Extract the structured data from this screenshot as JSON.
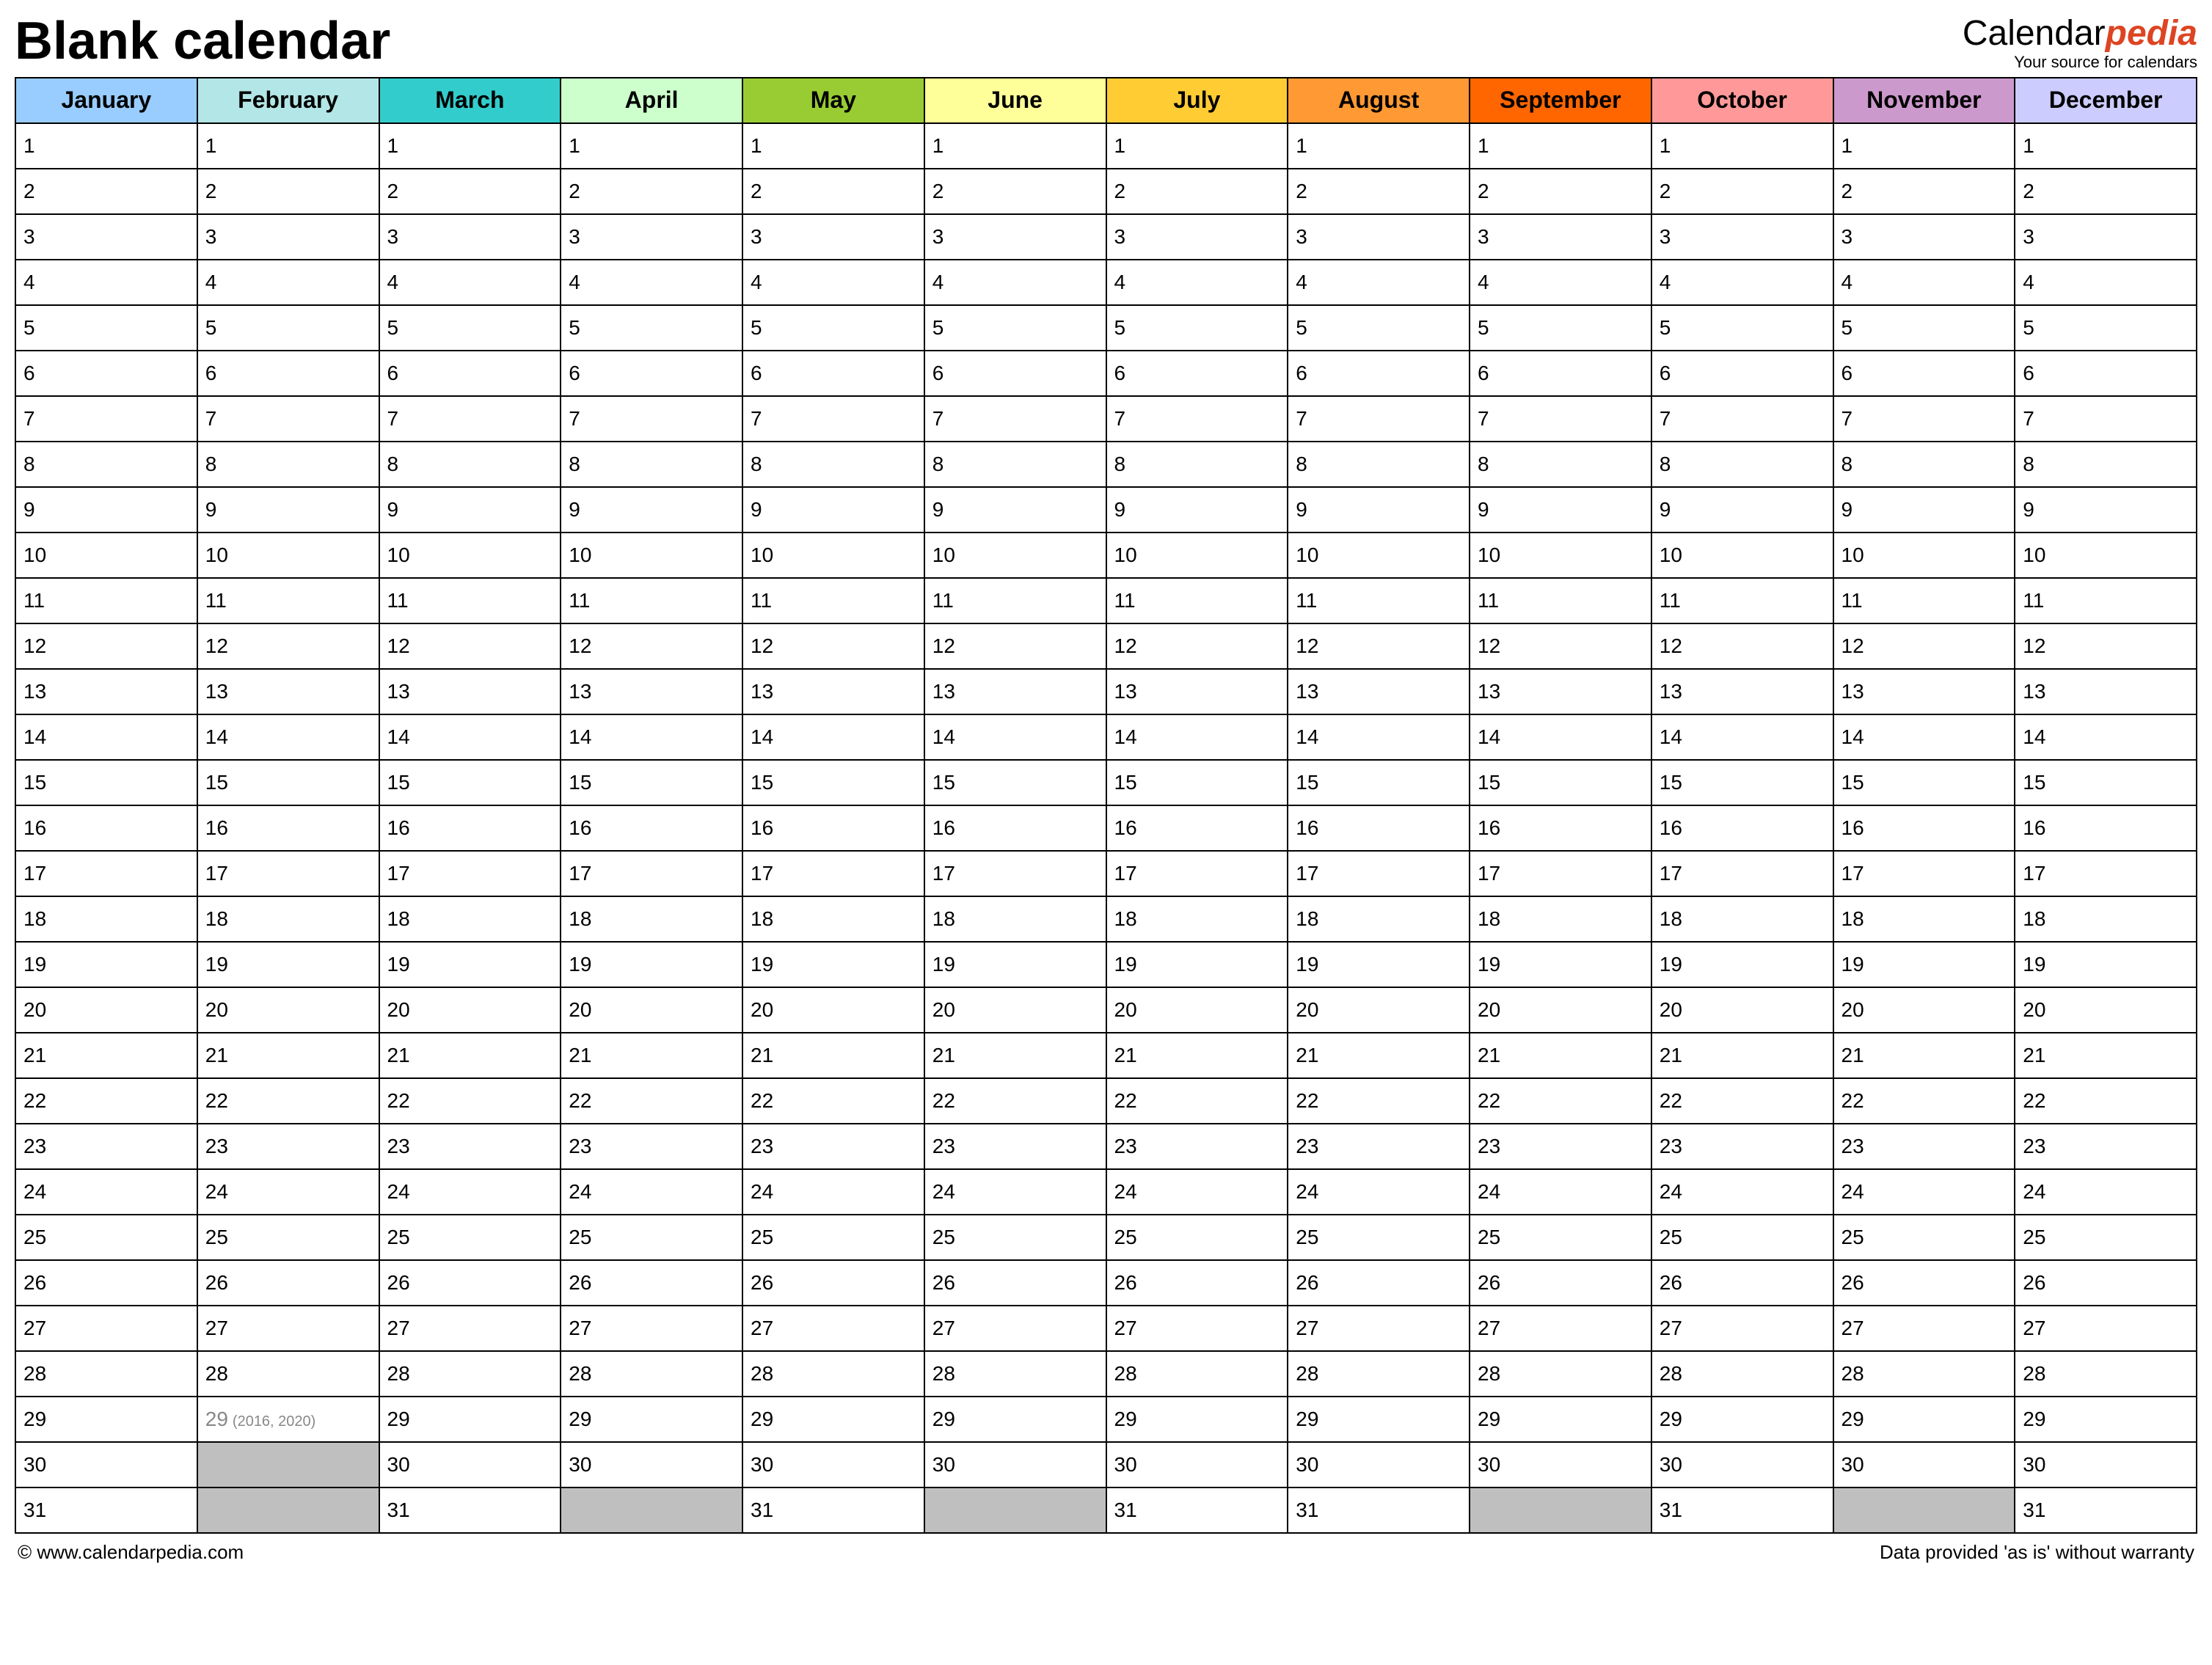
{
  "title": "Blank calendar",
  "logo": {
    "part1": "Calendar",
    "part2": "pedia",
    "tagline": "Your source for calendars"
  },
  "months": [
    {
      "name": "January",
      "color": "#99ccff",
      "days": 31
    },
    {
      "name": "February",
      "color": "#b3e6e6",
      "days": 28,
      "leap": {
        "day": 29,
        "note": "(2016, 2020)"
      }
    },
    {
      "name": "March",
      "color": "#33cccc",
      "days": 31
    },
    {
      "name": "April",
      "color": "#ccffcc",
      "days": 30
    },
    {
      "name": "May",
      "color": "#99cc33",
      "days": 31
    },
    {
      "name": "June",
      "color": "#ffff99",
      "days": 30
    },
    {
      "name": "July",
      "color": "#ffcc33",
      "days": 31
    },
    {
      "name": "August",
      "color": "#ff9933",
      "days": 31
    },
    {
      "name": "September",
      "color": "#ff6600",
      "days": 30
    },
    {
      "name": "October",
      "color": "#ff9999",
      "days": 31
    },
    {
      "name": "November",
      "color": "#cc99cc",
      "days": 30
    },
    {
      "name": "December",
      "color": "#ccccff",
      "days": 31
    }
  ],
  "maxDays": 31,
  "footer": {
    "left": "© www.calendarpedia.com",
    "right": "Data provided 'as is' without warranty"
  }
}
